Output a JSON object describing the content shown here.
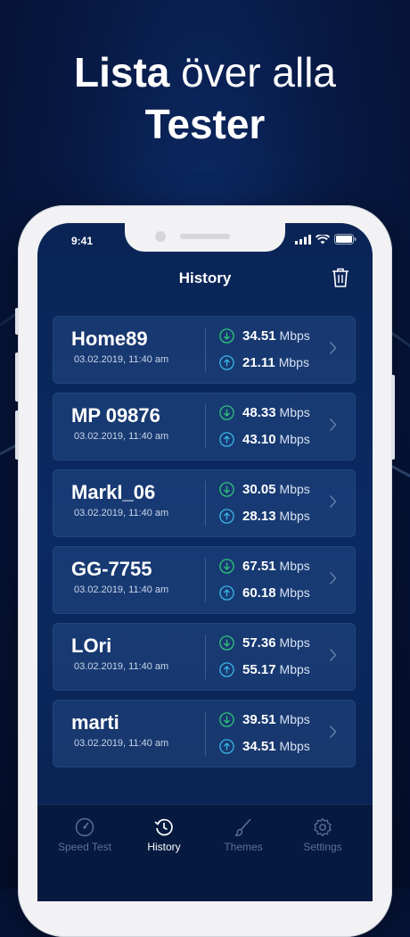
{
  "headline": {
    "line1_bold": "Lista",
    "line1_rest": " över alla",
    "line2": "Tester"
  },
  "status_bar": {
    "time": "9:41"
  },
  "screen": {
    "title": "History"
  },
  "history": [
    {
      "name": "Home89",
      "date": "03.02.2019, 11:40 am",
      "download": "34.51",
      "upload": "21.11"
    },
    {
      "name": "MP 09876",
      "date": "03.02.2019, 11:40 am",
      "download": "48.33",
      "upload": "43.10"
    },
    {
      "name": "MarkI_06",
      "date": "03.02.2019, 11:40 am",
      "download": "30.05",
      "upload": "28.13"
    },
    {
      "name": "GG-7755",
      "date": "03.02.2019, 11:40 am",
      "download": "67.51",
      "upload": "60.18"
    },
    {
      "name": "LOri",
      "date": "03.02.2019, 11:40 am",
      "download": "57.36",
      "upload": "55.17"
    },
    {
      "name": "marti",
      "date": "03.02.2019, 11:40 am",
      "download": "39.51",
      "upload": "34.51"
    }
  ],
  "unit": "Mbps",
  "tabs": [
    {
      "label": "Speed Test",
      "icon": "speedometer-icon",
      "active": false
    },
    {
      "label": "History",
      "icon": "history-icon",
      "active": true
    },
    {
      "label": "Themes",
      "icon": "brush-icon",
      "active": false
    },
    {
      "label": "Settings",
      "icon": "gear-icon",
      "active": false
    }
  ],
  "colors": {
    "download": "#2fc37a",
    "upload": "#39b5e6",
    "background": "#071a45"
  }
}
